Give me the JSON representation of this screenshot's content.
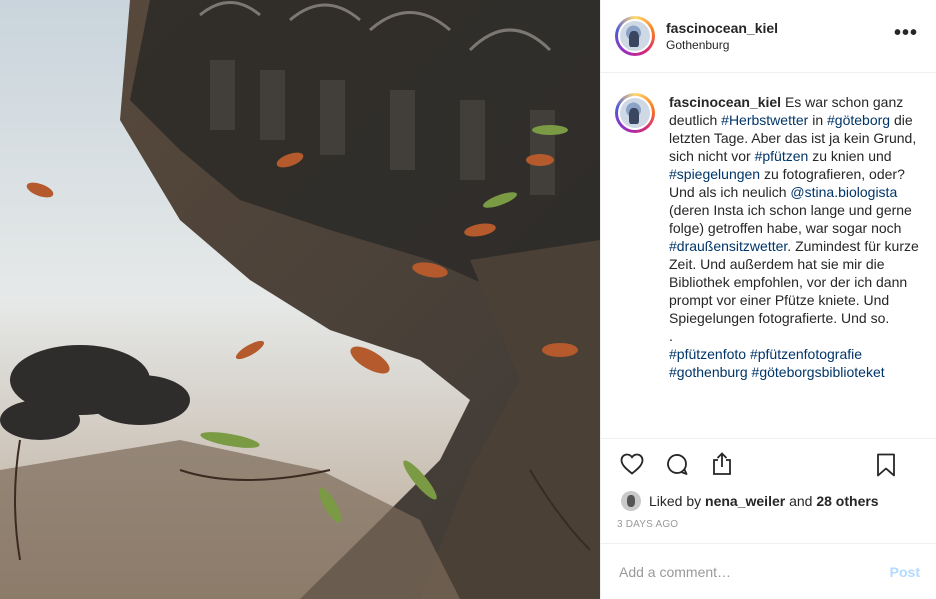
{
  "post": {
    "image_alt": "Reflection of a building in a puddle with autumn leaves"
  },
  "header": {
    "username": "fascinocean_kiel",
    "location": "Gothenburg",
    "more_icon": "more-dots-icon"
  },
  "caption": {
    "username": "fascinocean_kiel",
    "segments": [
      {
        "text": "Es war schon ganz deutlich ",
        "tag": false
      },
      {
        "text": "#Herbstwetter",
        "tag": true
      },
      {
        "text": " in ",
        "tag": false
      },
      {
        "text": "#göteborg",
        "tag": true
      },
      {
        "text": " die letzten Tage. Aber das ist ja kein Grund, sich nicht vor ",
        "tag": false
      },
      {
        "text": "#pfützen",
        "tag": true
      },
      {
        "text": " zu knien und ",
        "tag": false
      },
      {
        "text": "#spiegelungen",
        "tag": true
      },
      {
        "text": " zu fotografieren, oder? Und als ich neulich ",
        "tag": false
      },
      {
        "text": "@stina.biologista",
        "tag": true
      },
      {
        "text": " (deren Insta ich schon lange und gerne folge) getroffen habe, war sogar noch ",
        "tag": false
      },
      {
        "text": "#draußensitzwetter",
        "tag": true
      },
      {
        "text": ". Zumindest für kurze Zeit. Und außerdem hat sie mir die Bibliothek empfohlen, vor der ich dann prompt vor einer Pfütze kniete. Und Spiegelungen fotografierte. Und so.",
        "tag": false
      },
      {
        "text": "\n.\n",
        "tag": false
      },
      {
        "text": "#pfützenfoto",
        "tag": true
      },
      {
        "text": " ",
        "tag": false
      },
      {
        "text": "#pfützenfotografie",
        "tag": true
      },
      {
        "text": " ",
        "tag": false
      },
      {
        "text": "#gothenburg",
        "tag": true
      },
      {
        "text": " ",
        "tag": false
      },
      {
        "text": "#göteborgsbiblioteket",
        "tag": true
      }
    ]
  },
  "actions": {
    "like_icon": "heart-icon",
    "comment_icon": "comment-icon",
    "share_icon": "share-icon",
    "save_icon": "bookmark-icon"
  },
  "likes": {
    "prefix": "Liked by",
    "user": "nena_weiler",
    "and": "and",
    "others": "28 others"
  },
  "timestamp": "3 DAYS AGO",
  "comment_box": {
    "placeholder": "Add a comment…",
    "post_label": "Post"
  },
  "colors": {
    "hashtag": "#003569",
    "post_disabled": "#b3dbff",
    "muted": "#999999"
  }
}
